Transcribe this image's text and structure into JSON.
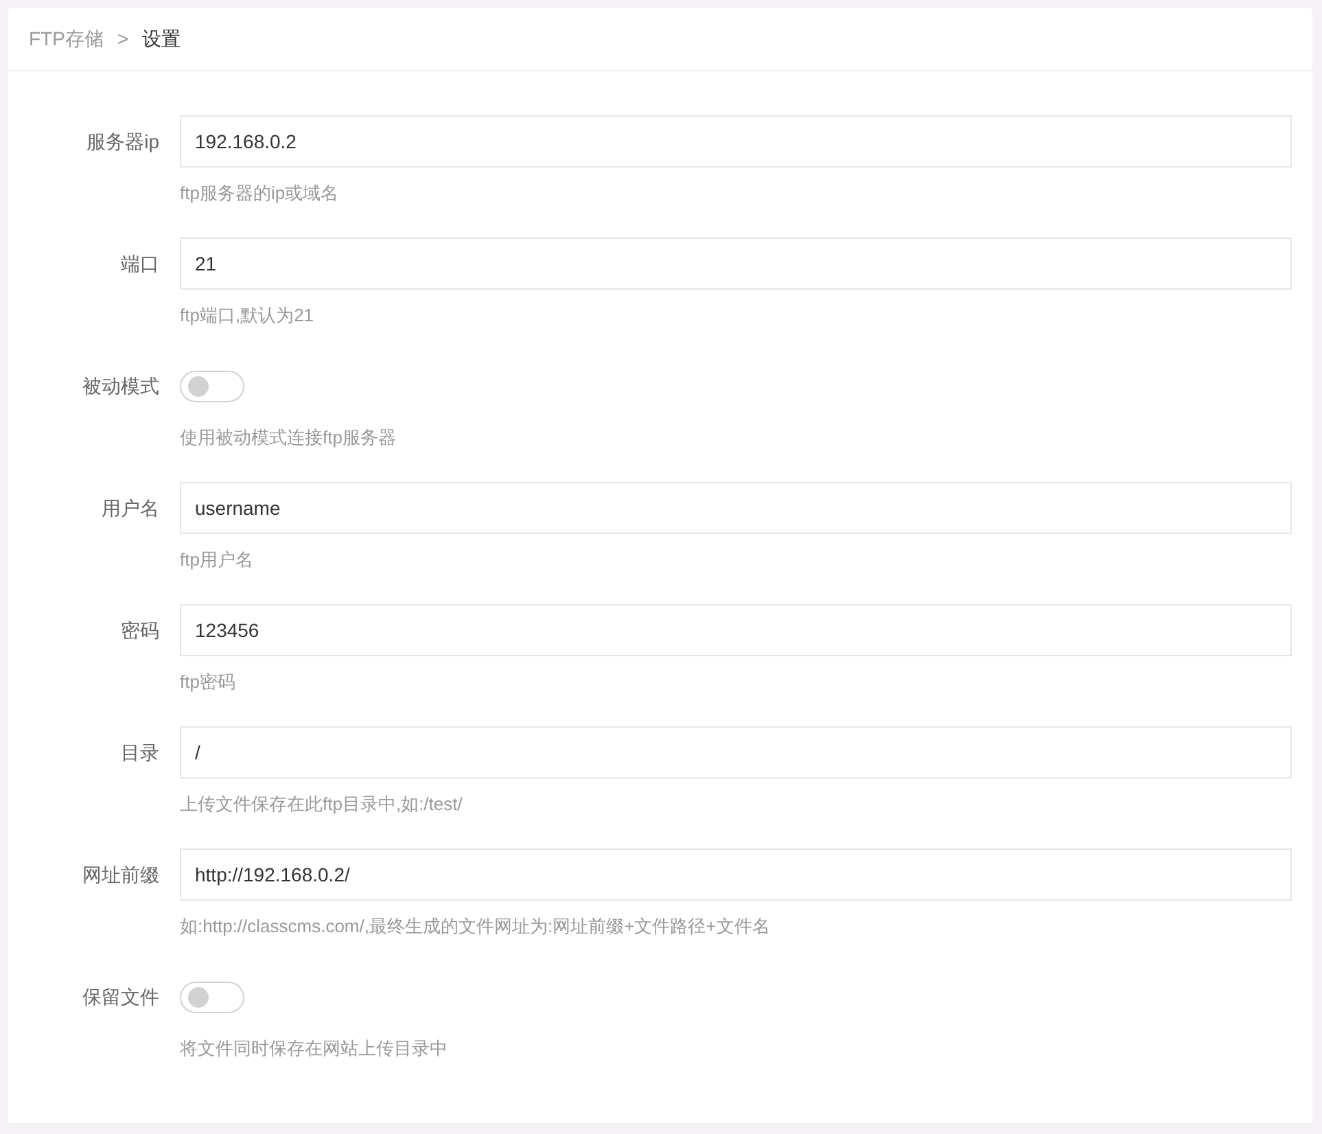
{
  "breadcrumb": [
    {
      "label": "FTP存储",
      "current": false
    },
    {
      "label": "设置",
      "current": true
    }
  ],
  "breadcrumb_separator": ">",
  "fields": [
    {
      "kind": "input",
      "label": "服务器ip",
      "value": "192.168.0.2",
      "hint": "ftp服务器的ip或域名"
    },
    {
      "kind": "input",
      "label": "端口",
      "value": "21",
      "hint": "ftp端口,默认为21"
    },
    {
      "kind": "switch",
      "label": "被动模式",
      "on": false,
      "hint": "使用被动模式连接ftp服务器"
    },
    {
      "kind": "input",
      "label": "用户名",
      "value": "username",
      "hint": "ftp用户名"
    },
    {
      "kind": "input",
      "label": "密码",
      "value": "123456",
      "hint": "ftp密码"
    },
    {
      "kind": "input",
      "label": "目录",
      "value": "/",
      "hint": "上传文件保存在此ftp目录中,如:/test/"
    },
    {
      "kind": "input",
      "label": "网址前缀",
      "value": "http://192.168.0.2/",
      "hint": "如:http://classcms.com/,最终生成的文件网址为:网址前缀+文件路径+文件名"
    },
    {
      "kind": "switch",
      "label": "保留文件",
      "on": false,
      "hint": "将文件同时保存在网站上传目录中"
    }
  ]
}
